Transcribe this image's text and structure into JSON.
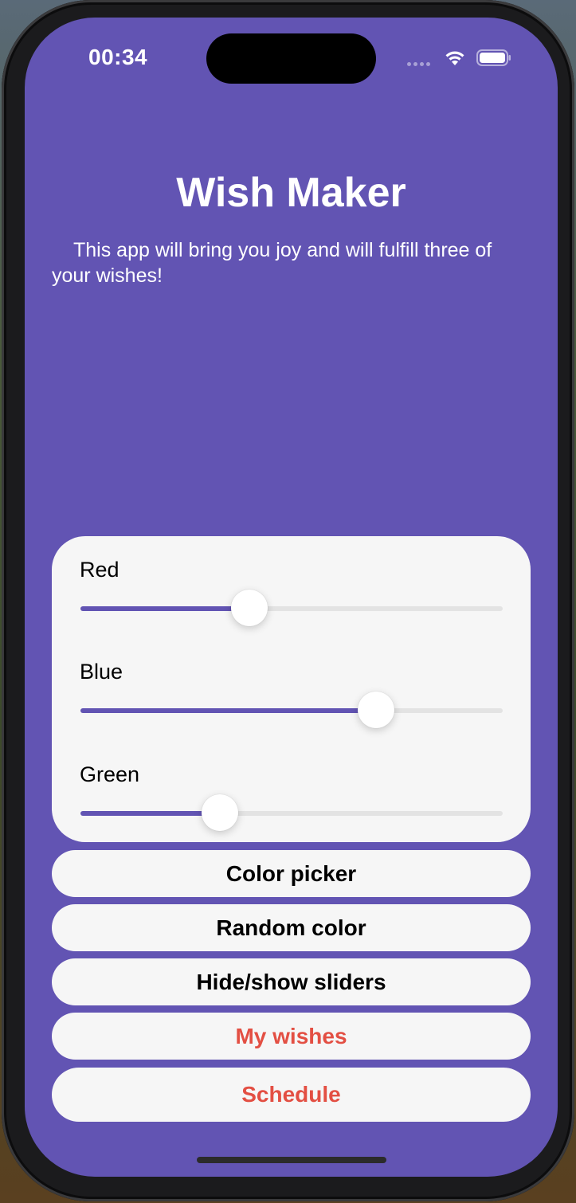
{
  "status_bar": {
    "time": "00:34",
    "icons": [
      "cellular-signal-icon",
      "wifi-icon",
      "battery-icon"
    ]
  },
  "header": {
    "title": "Wish Maker",
    "subtitle": "This app will bring you joy and will fulfill three of your wishes!"
  },
  "sliders": [
    {
      "label": "Red",
      "value": 0.4
    },
    {
      "label": "Blue",
      "value": 0.7
    },
    {
      "label": "Green",
      "value": 0.33
    }
  ],
  "buttons": {
    "color_picker": "Color picker",
    "random_color": "Random color",
    "toggle_sliders": "Hide/show sliders",
    "my_wishes": "My wishes",
    "schedule": "Schedule"
  },
  "colors": {
    "background": "#6254b3",
    "card": "#f6f6f6",
    "accent_text": "#e34f43",
    "slider_fill": "#6254b3"
  }
}
